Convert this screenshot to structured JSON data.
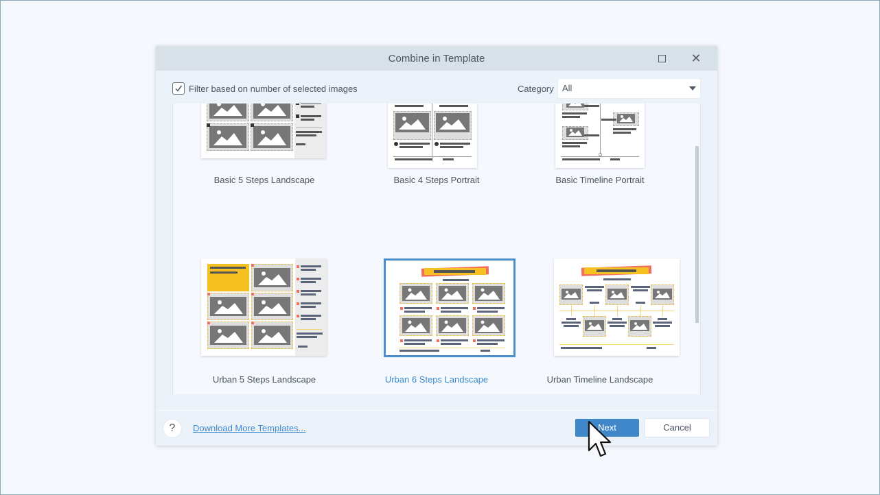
{
  "dialog": {
    "title": "Combine in Template",
    "maximize_icon": "maximize-icon",
    "close_icon": "close-icon",
    "close_glyph": "✕"
  },
  "filter": {
    "checked": true,
    "label": "Filter based on number of selected images",
    "check_icon": "checkmark-icon"
  },
  "category": {
    "label": "Category",
    "selected": "All",
    "dropdown_icon": "caret-down-icon"
  },
  "templates": [
    {
      "name": "Basic 5 Steps Landscape",
      "selected": false
    },
    {
      "name": "Basic 4 Steps Portrait",
      "selected": false
    },
    {
      "name": "Basic Timeline Portrait",
      "selected": false
    },
    {
      "name": "Urban 5 Steps Landscape",
      "selected": false
    },
    {
      "name": "Urban 6 Steps Landscape",
      "selected": true
    },
    {
      "name": "Urban Timeline Landscape",
      "selected": false
    },
    {
      "name": "",
      "selected": false
    }
  ],
  "footer": {
    "help_glyph": "?",
    "download_link": "Download More Templates...",
    "next_label": "Next",
    "cancel_label": "Cancel"
  },
  "colors": {
    "accent": "#3f87c9",
    "selected_text": "#3c8bd1",
    "title_bar": "#d8e0e8",
    "dialog_bg": "#ebf2f9",
    "urban_yellow": "#f5c020",
    "urban_red": "#f07060"
  }
}
